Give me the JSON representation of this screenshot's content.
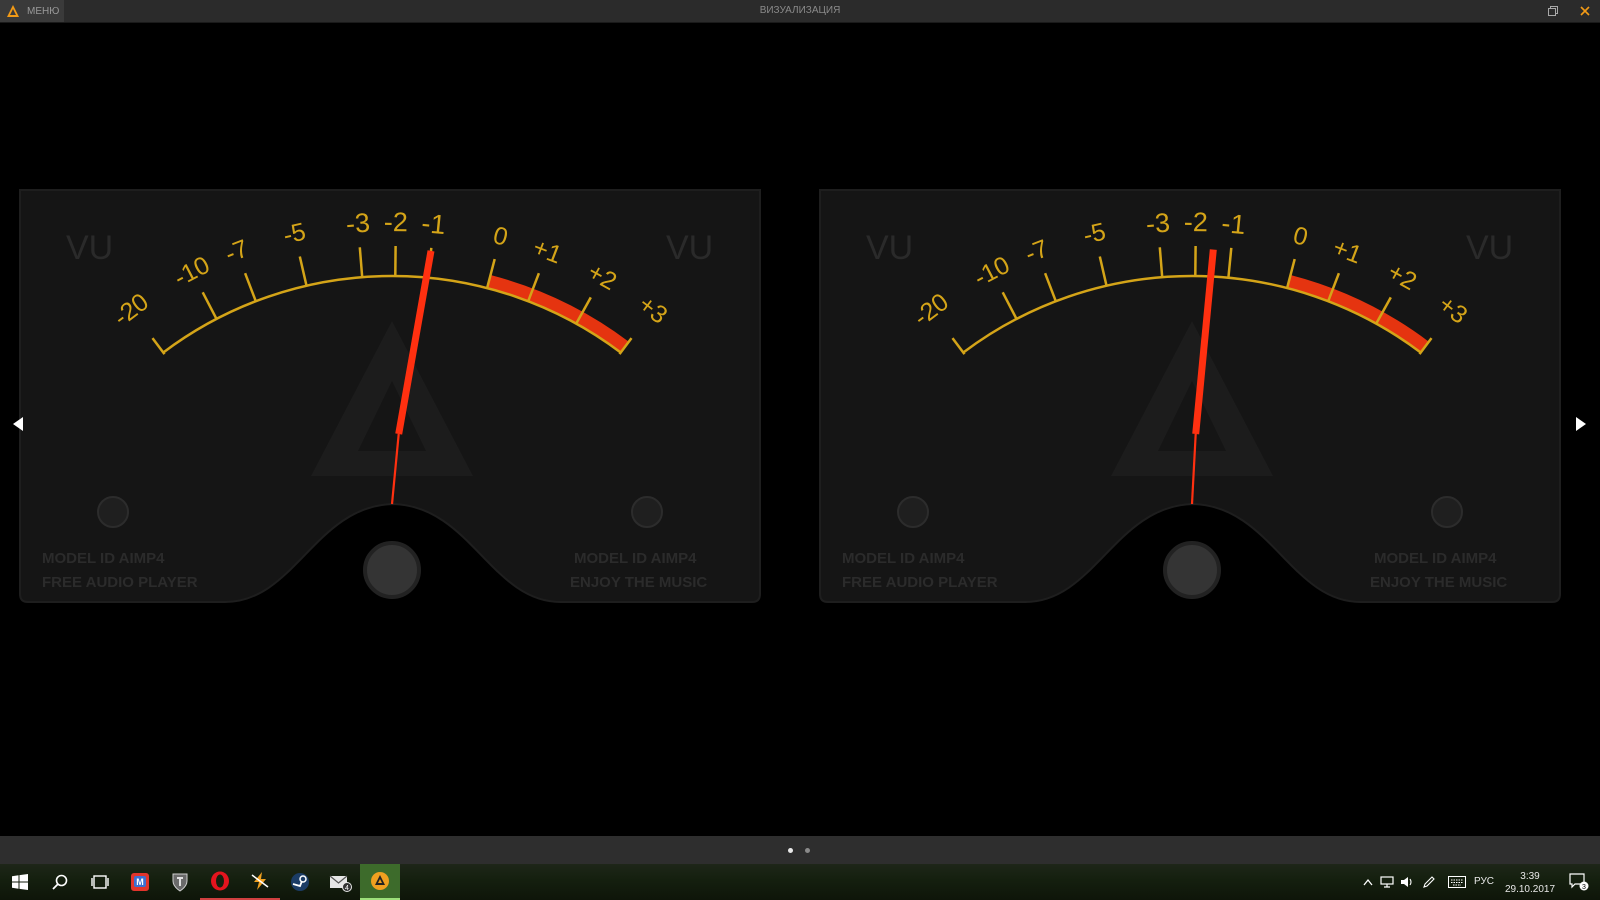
{
  "titlebar": {
    "menu_label": "МЕНЮ",
    "title": "ВИЗУАЛИЗАЦИЯ"
  },
  "meters": [
    {
      "vu_left": "VU",
      "vu_right": "VU",
      "scale_labels": [
        "-20",
        "-10",
        "-7",
        "-5",
        "-3",
        "-2",
        "-1",
        "0",
        "+1",
        "+2",
        "+3"
      ],
      "model_left_1": "MODEL ID AIMP4",
      "model_left_2": "FREE AUDIO PLAYER",
      "model_right_1": "MODEL ID AIMP4",
      "model_right_2": "ENJOY THE MUSIC",
      "needle_value": "-1"
    },
    {
      "vu_left": "VU",
      "vu_right": "VU",
      "scale_labels": [
        "-20",
        "-10",
        "-7",
        "-5",
        "-3",
        "-2",
        "-1",
        "0",
        "+1",
        "+2",
        "+3"
      ],
      "model_left_1": "MODEL ID AIMP4",
      "model_left_2": "FREE AUDIO PLAYER",
      "model_right_1": "MODEL ID AIMP4",
      "model_right_2": "ENJOY THE MUSIC",
      "needle_value": "-1.5"
    }
  ],
  "pager": {
    "pages": 2,
    "active": 1
  },
  "taskbar": {
    "apps": [
      "start-icon",
      "search-icon",
      "task-view-icon",
      "vk-messenger-icon",
      "world-of-tanks-icon",
      "opera-icon",
      "winamp-icon",
      "steam-icon",
      "mail-icon",
      "aimp-icon"
    ],
    "mail_badge": "4",
    "language": "РУС",
    "time": "3:39",
    "date": "29.10.2017",
    "notifications": "3"
  },
  "colors": {
    "scale": "#d4a418",
    "redzone": "#e53410",
    "needle": "#ff3010",
    "panel": "#151515"
  }
}
